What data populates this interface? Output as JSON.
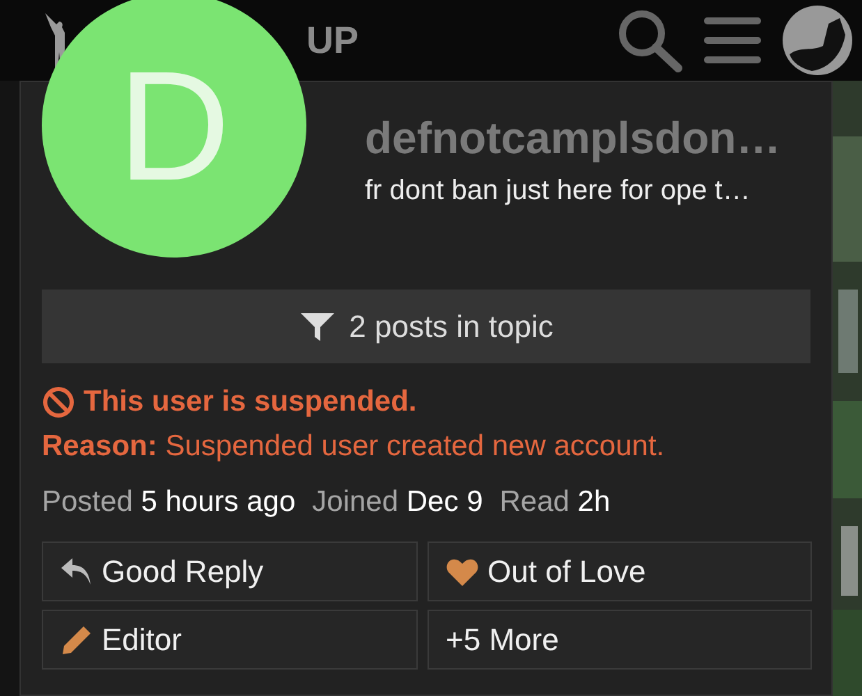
{
  "header": {
    "logo_text": "UP"
  },
  "user": {
    "initial": "D",
    "name": "defnotcamplsdon…",
    "bio": "fr dont ban just here for ope t…"
  },
  "filter_button": {
    "label": "2 posts in topic"
  },
  "suspension": {
    "title": "This user is suspended.",
    "reason_label": "Reason:",
    "reason": "Suspended user created new account."
  },
  "stats": [
    {
      "label": "Posted",
      "value": "5 hours ago"
    },
    {
      "label": "Joined",
      "value": "Dec 9"
    },
    {
      "label": "Read",
      "value": "2h"
    }
  ],
  "badges": [
    {
      "kind": "reply",
      "label": "Good Reply"
    },
    {
      "kind": "heart",
      "label": "Out of Love"
    },
    {
      "kind": "pencil",
      "label": "Editor"
    },
    {
      "kind": "more",
      "label": "+5 More"
    }
  ]
}
